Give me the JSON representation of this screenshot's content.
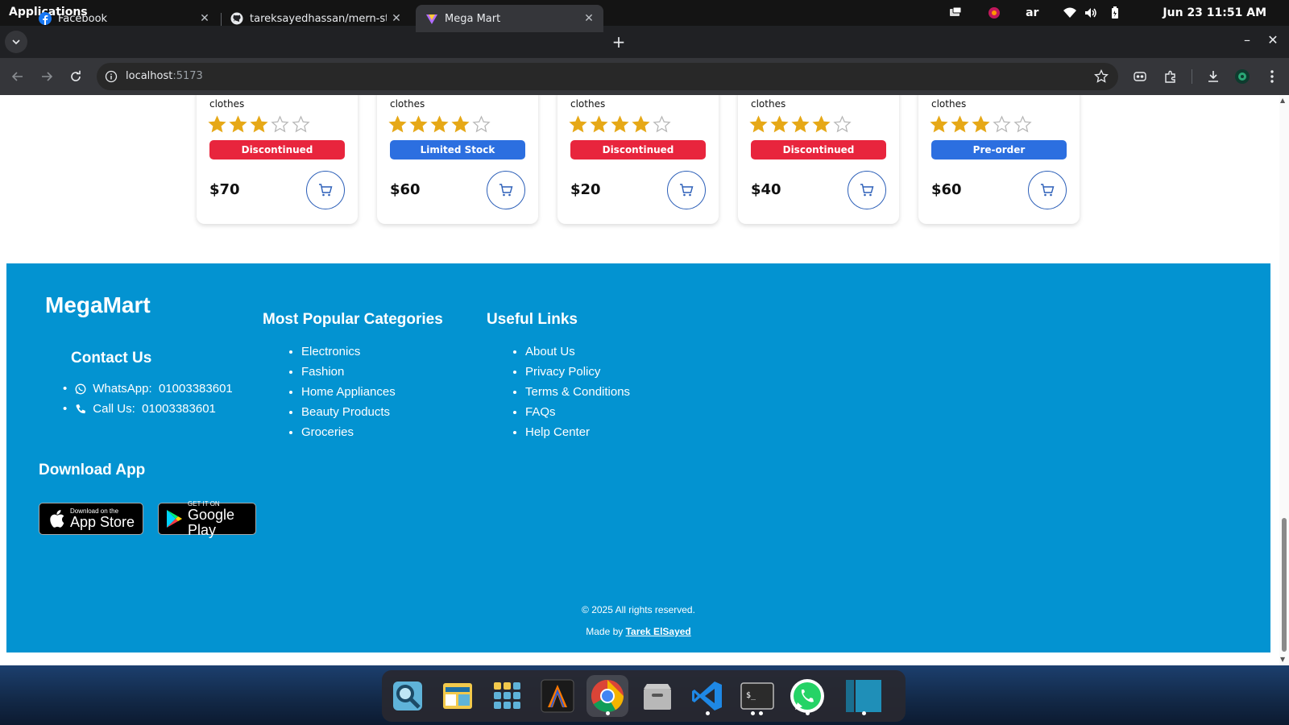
{
  "system": {
    "applications_label": "Applications",
    "lang": "ar",
    "clock": "Jun 23  11:51 AM"
  },
  "tabs": [
    {
      "title": "Facebook",
      "icon": "facebook-icon"
    },
    {
      "title": "tareksayedhassan/mern-sta",
      "icon": "github-icon"
    },
    {
      "title": "Mega Mart",
      "icon": "megamart-icon",
      "active": true
    }
  ],
  "address": {
    "host": "localhost",
    "port": ":5173"
  },
  "products": [
    {
      "category": "clothes",
      "rating": 3,
      "badge": "Discontinued",
      "badge_color": "#e8253d",
      "price": "$70"
    },
    {
      "category": "clothes",
      "rating": 4,
      "badge": "Limited Stock",
      "badge_color": "#2c6fe0",
      "price": "$60"
    },
    {
      "category": "clothes",
      "rating": 4,
      "badge": "Discontinued",
      "badge_color": "#e8253d",
      "price": "$20"
    },
    {
      "category": "clothes",
      "rating": 4,
      "badge": "Discontinued",
      "badge_color": "#e8253d",
      "price": "$40"
    },
    {
      "category": "clothes",
      "rating": 3,
      "badge": "Pre-order",
      "badge_color": "#2c6fe0",
      "price": "$60"
    }
  ],
  "footer": {
    "brand": "MegaMart",
    "contact_title": "Contact Us",
    "whatsapp_label": "WhatsApp:",
    "whatsapp_number": "01003383601",
    "call_label": "Call Us:",
    "call_number": "01003383601",
    "categories_title": "Most Popular Categories",
    "categories": [
      "Electronics",
      "Fashion",
      "Home Appliances",
      "Beauty Products",
      "Groceries"
    ],
    "links_title": "Useful Links",
    "links": [
      "About Us",
      "Privacy Policy",
      "Terms & Conditions",
      "FAQs",
      "Help Center"
    ],
    "download_title": "Download App",
    "appstore_small": "Download on the",
    "appstore_big": "App Store",
    "googleplay_small": "GET IT ON",
    "googleplay_big": "Google Play",
    "copyright": "© 2025 All rights reserved.",
    "made_by_prefix": "Made by",
    "author": "Tarek ElSayed",
    "bg_color": "#0393d1"
  },
  "dock": [
    "search-app-icon",
    "files-manager-icon",
    "app-grid-icon",
    "terminal-app-icon",
    "chrome-icon",
    "file-cabinet-icon",
    "vscode-icon",
    "console-icon",
    "whatsapp-icon",
    "panel-app-icon"
  ]
}
